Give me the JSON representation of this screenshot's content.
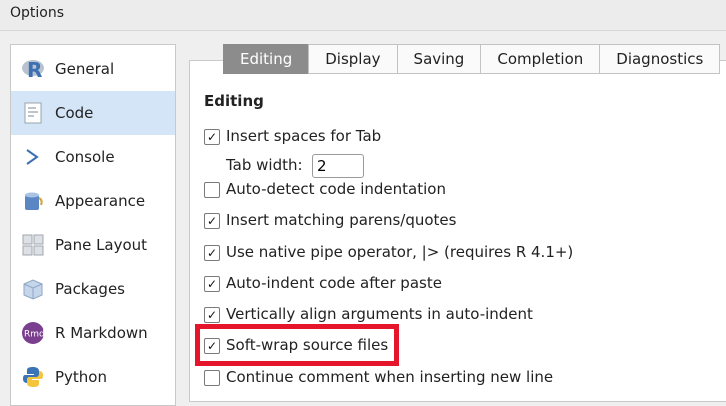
{
  "window": {
    "title": "Options"
  },
  "sidebar": {
    "items": [
      {
        "label": "General",
        "icon": "r-logo-icon",
        "selected": false
      },
      {
        "label": "Code",
        "icon": "code-document-icon",
        "selected": true
      },
      {
        "label": "Console",
        "icon": "console-prompt-icon",
        "selected": false
      },
      {
        "label": "Appearance",
        "icon": "paint-bucket-icon",
        "selected": false
      },
      {
        "label": "Pane Layout",
        "icon": "pane-layout-icon",
        "selected": false
      },
      {
        "label": "Packages",
        "icon": "package-box-icon",
        "selected": false
      },
      {
        "label": "R Markdown",
        "icon": "rmd-icon",
        "selected": false
      },
      {
        "label": "Python",
        "icon": "python-logo-icon",
        "selected": false
      }
    ]
  },
  "tabs": [
    {
      "label": "Editing",
      "active": true
    },
    {
      "label": "Display",
      "active": false
    },
    {
      "label": "Saving",
      "active": false
    },
    {
      "label": "Completion",
      "active": false
    },
    {
      "label": "Diagnostics",
      "active": false
    }
  ],
  "editing": {
    "section_title": "Editing",
    "tab_width_label": "Tab width:",
    "tab_width_value": "2",
    "options": [
      {
        "label": "Insert spaces for Tab",
        "checked": true
      },
      {
        "label": "Auto-detect code indentation",
        "checked": false
      },
      {
        "label": "Insert matching parens/quotes",
        "checked": true
      },
      {
        "label": "Use native pipe operator, |> (requires R 4.1+)",
        "checked": true
      },
      {
        "label": "Auto-indent code after paste",
        "checked": true
      },
      {
        "label": "Vertically align arguments in auto-indent",
        "checked": true
      },
      {
        "label": "Soft-wrap source files",
        "checked": true
      },
      {
        "label": "Continue comment when inserting new line",
        "checked": false
      }
    ]
  },
  "check_glyph": "✓",
  "colors": {
    "selected_bg": "#d3e5f6",
    "active_tab": "#8c8c8c",
    "highlight": "#e5162c"
  }
}
